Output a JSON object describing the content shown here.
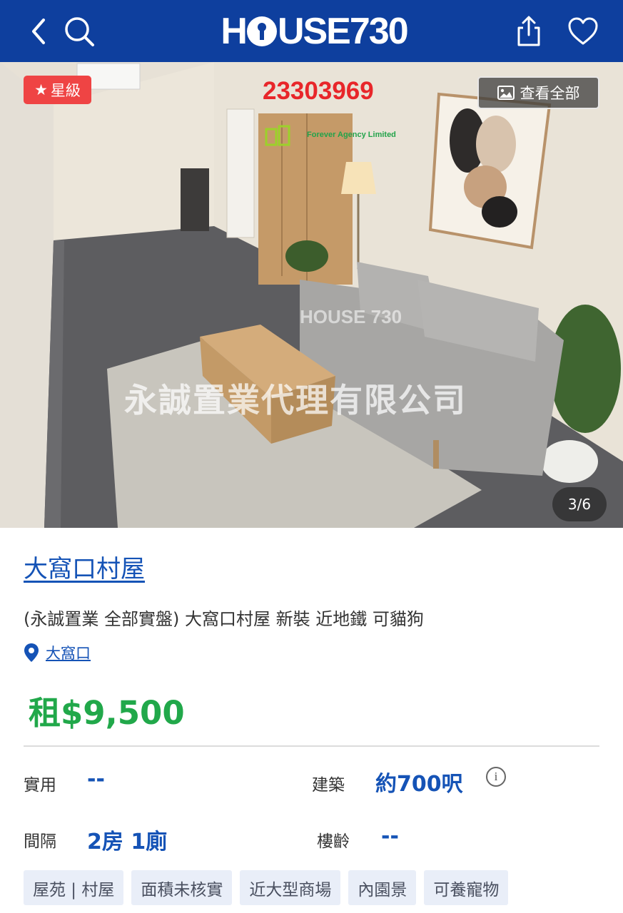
{
  "header": {
    "logo_text": "HOUSE730",
    "logo_prefix": "H",
    "logo_suffix": "USE730"
  },
  "photo": {
    "badge_label": "星級",
    "view_all_label": "查看全部",
    "counter": "3/6",
    "agency_phone": "23303969",
    "agency_name_en": "Forever Agency Limited",
    "watermark_text": "永誠置業代理有限公司",
    "watermark_logo": "HOUSE 730"
  },
  "listing": {
    "title": "大窩口村屋",
    "subtitle": "(永誠置業 全部實盤) 大窩口村屋 新裝 近地鐵 可貓狗",
    "location": "大窩口",
    "price": "租$9,500"
  },
  "specs": {
    "saleable_label": "實用",
    "saleable_value": "--",
    "gross_label": "建築",
    "gross_value": "約700呎",
    "layout_label": "間隔",
    "layout_value": "2房 1廁",
    "age_label": "樓齡",
    "age_value": "--"
  },
  "tags": [
    "屋苑 | 村屋",
    "面積未核實",
    "近大型商場",
    "內園景",
    "可養寵物"
  ],
  "colors": {
    "header_bg": "#0e3f9e",
    "link_blue": "#1553b6",
    "price_green": "#21a84a",
    "badge_red": "#ef4444",
    "tag_bg": "#e9eef8"
  }
}
